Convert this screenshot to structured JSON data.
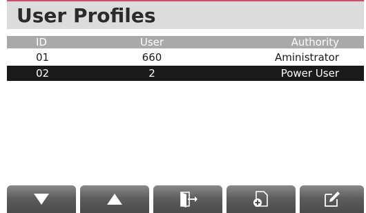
{
  "title": "User Profiles",
  "columns": {
    "id": "ID",
    "user": "User",
    "authority": "Authority"
  },
  "rows": [
    {
      "id": "01",
      "user": "660",
      "authority": "Aministrator"
    },
    {
      "id": "02",
      "user": "2",
      "authority": "Power User"
    }
  ],
  "toolbar": {
    "buttons": [
      {
        "icon": "arrow-down-icon"
      },
      {
        "icon": "arrow-up-icon"
      },
      {
        "icon": "exit-icon"
      },
      {
        "icon": "add-document-icon"
      },
      {
        "icon": "edit-icon"
      }
    ]
  },
  "colors": {
    "accent": "#d44a6a",
    "header_bg": "#a9a9a9",
    "selected_row": "#1a1a1a"
  }
}
